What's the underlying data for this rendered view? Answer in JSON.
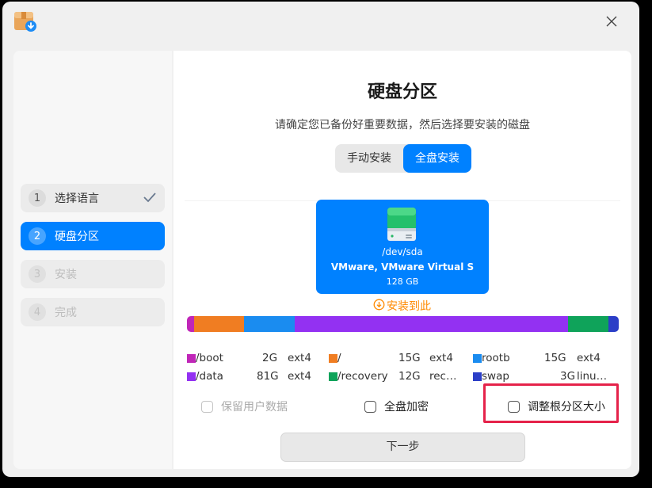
{
  "colors": {
    "accent": "#0081ff",
    "install_here": "#ff8a00",
    "highlight": "#e5224a"
  },
  "titlebar": {
    "app_icon": "installer-icon",
    "close_icon": "close-icon"
  },
  "steps": [
    {
      "num": "1",
      "label": "选择语言",
      "state": "done"
    },
    {
      "num": "2",
      "label": "硬盘分区",
      "state": "active"
    },
    {
      "num": "3",
      "label": "安装",
      "state": "pending"
    },
    {
      "num": "4",
      "label": "完成",
      "state": "pending"
    }
  ],
  "main": {
    "title": "硬盘分区",
    "subtitle": "请确定您已备份好重要数据，然后选择要安装的磁盘",
    "tabs": [
      {
        "label": "手动安装",
        "selected": false
      },
      {
        "label": "全盘安装",
        "selected": true
      }
    ]
  },
  "disk": {
    "path": "/dev/sda",
    "model": "VMware, VMware Virtual S",
    "size": "128 GB",
    "install_here": "安装到此"
  },
  "partitions": [
    {
      "name": "/boot",
      "size": "2G",
      "fs": "ext4",
      "color": "#c026b8",
      "gb": 2
    },
    {
      "name": "/",
      "size": "15G",
      "fs": "ext4",
      "color": "#f07d22",
      "gb": 15
    },
    {
      "name": "rootb",
      "size": "15G",
      "fs": "ext4",
      "color": "#1a8cf0",
      "gb": 15
    },
    {
      "name": "/data",
      "size": "81G",
      "fs": "ext4",
      "color": "#9331f2",
      "gb": 81
    },
    {
      "name": "/recovery",
      "size": "12G",
      "fs": "rec…",
      "color": "#0fa35a",
      "gb": 12
    },
    {
      "name": "swap",
      "size": "3G",
      "fs": "linu…",
      "color": "#2b3ec7",
      "gb": 3
    }
  ],
  "options": {
    "keep_user_data": "保留用户数据",
    "full_disk_encrypt": "全盘加密",
    "resize_root": "调整根分区大小"
  },
  "next_label": "下一步"
}
